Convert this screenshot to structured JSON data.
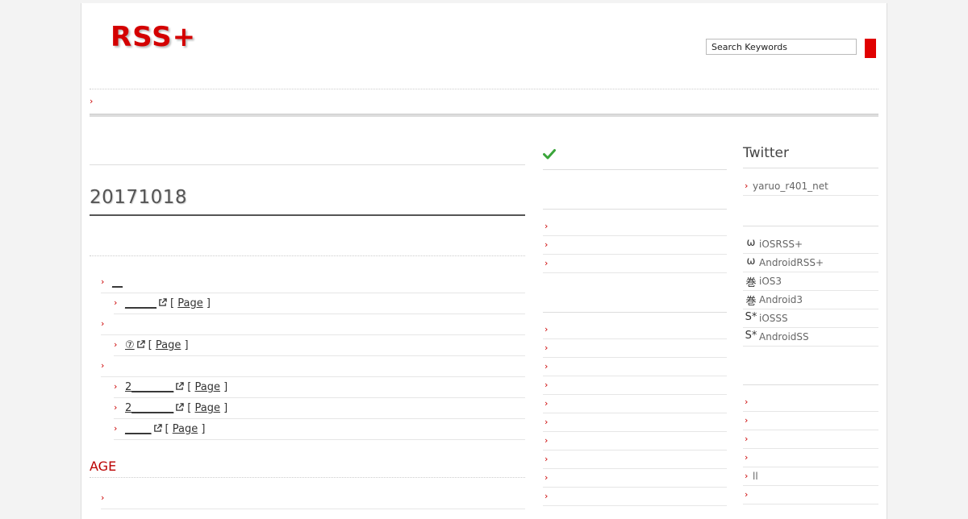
{
  "header": {
    "logo": "RSS+",
    "search_placeholder": "Search Keywords"
  },
  "main": {
    "date_title": "20171018",
    "rows": [
      {
        "level": 1,
        "text": "__",
        "page": ""
      },
      {
        "level": 2,
        "text": "______",
        "page": "Page"
      },
      {
        "level": 1,
        "text": "",
        "page": ""
      },
      {
        "level": 2,
        "text": "⑦",
        "page": "Page"
      },
      {
        "level": 1,
        "text": "",
        "page": ""
      },
      {
        "level": 2,
        "text": " 2________",
        "page": "Page"
      },
      {
        "level": 2,
        "text": " 2________",
        "page": "Page"
      },
      {
        "level": 2,
        "text": "_____",
        "page": "Page"
      }
    ],
    "age_label": "AGE"
  },
  "sidebar": {
    "twitter_title": "Twitter",
    "twitter_account": "yaruo_r401_net",
    "apps": [
      {
        "icon": "ω",
        "icon_name": "omega-icon",
        "label": "iOSRSS+"
      },
      {
        "icon": "ω",
        "icon_name": "omega-icon",
        "label": "AndroidRSS+"
      },
      {
        "icon": "巻",
        "icon_name": "scroll-kanji-icon",
        "label": "iOS3"
      },
      {
        "icon": "巻",
        "icon_name": "scroll-kanji-icon",
        "label": "Android3"
      },
      {
        "icon": "S*",
        "icon_name": "s-star-icon",
        "label": "iOSSS"
      },
      {
        "icon": "S*",
        "icon_name": "s-star-icon",
        "label": "AndroidSS"
      }
    ],
    "links": [
      "",
      "",
      "",
      "",
      "ll",
      ""
    ]
  },
  "colors": {
    "accent": "#d40000",
    "check": "#3aa53a"
  }
}
